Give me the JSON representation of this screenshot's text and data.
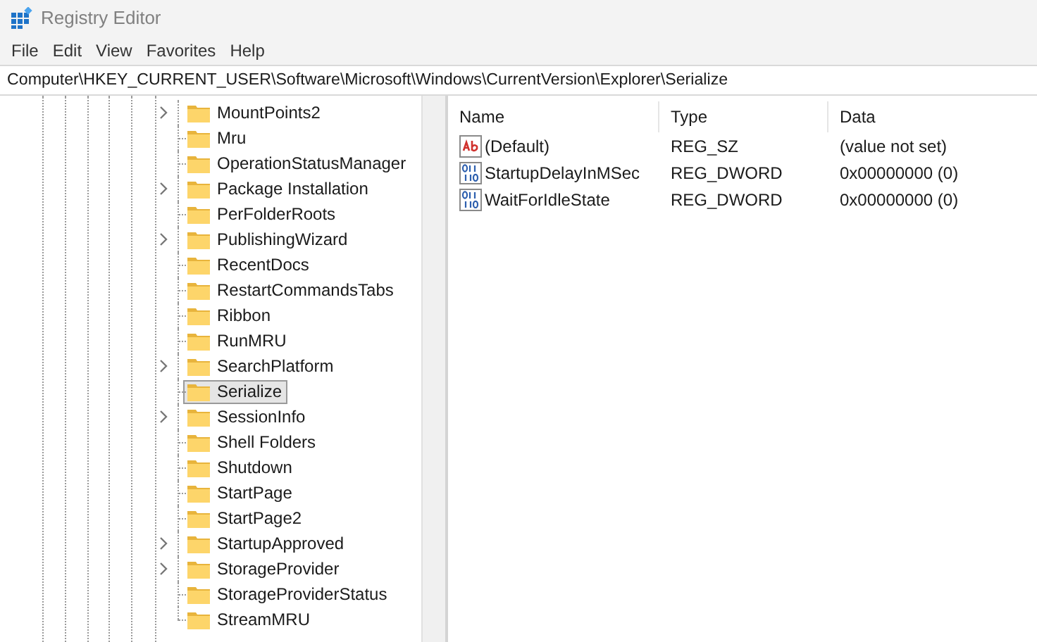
{
  "window": {
    "title": "Registry Editor"
  },
  "menu": [
    "File",
    "Edit",
    "View",
    "Favorites",
    "Help"
  ],
  "address": "Computer\\HKEY_CURRENT_USER\\Software\\Microsoft\\Windows\\CurrentVersion\\Explorer\\Serialize",
  "tree": [
    {
      "label": "MountPoints2",
      "expandable": true,
      "selected": false
    },
    {
      "label": "Mru",
      "expandable": false,
      "selected": false
    },
    {
      "label": "OperationStatusManager",
      "expandable": false,
      "selected": false
    },
    {
      "label": "Package Installation",
      "expandable": true,
      "selected": false
    },
    {
      "label": "PerFolderRoots",
      "expandable": false,
      "selected": false
    },
    {
      "label": "PublishingWizard",
      "expandable": true,
      "selected": false
    },
    {
      "label": "RecentDocs",
      "expandable": false,
      "selected": false
    },
    {
      "label": "RestartCommandsTabs",
      "expandable": false,
      "selected": false
    },
    {
      "label": "Ribbon",
      "expandable": false,
      "selected": false
    },
    {
      "label": "RunMRU",
      "expandable": false,
      "selected": false
    },
    {
      "label": "SearchPlatform",
      "expandable": true,
      "selected": false
    },
    {
      "label": "Serialize",
      "expandable": false,
      "selected": true
    },
    {
      "label": "SessionInfo",
      "expandable": true,
      "selected": false
    },
    {
      "label": "Shell Folders",
      "expandable": false,
      "selected": false
    },
    {
      "label": "Shutdown",
      "expandable": false,
      "selected": false
    },
    {
      "label": "StartPage",
      "expandable": false,
      "selected": false
    },
    {
      "label": "StartPage2",
      "expandable": false,
      "selected": false
    },
    {
      "label": "StartupApproved",
      "expandable": true,
      "selected": false
    },
    {
      "label": "StorageProvider",
      "expandable": true,
      "selected": false
    },
    {
      "label": "StorageProviderStatus",
      "expandable": false,
      "selected": false
    },
    {
      "label": "StreamMRU",
      "expandable": false,
      "selected": false
    }
  ],
  "table": {
    "columns": [
      "Name",
      "Type",
      "Data"
    ],
    "rows": [
      {
        "kind": "string",
        "name": "(Default)",
        "type": "REG_SZ",
        "data": "(value not set)"
      },
      {
        "kind": "binary",
        "name": "StartupDelayInMSec",
        "type": "REG_DWORD",
        "data": "0x00000000 (0)"
      },
      {
        "kind": "binary",
        "name": "WaitForIdleState",
        "type": "REG_DWORD",
        "data": "0x00000000 (0)"
      }
    ]
  }
}
